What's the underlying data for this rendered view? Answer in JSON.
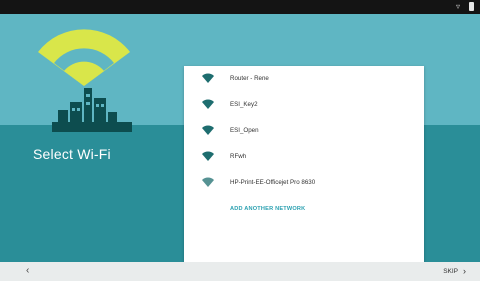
{
  "title": "Select Wi-Fi",
  "networks": [
    {
      "name": "Router - Rene",
      "icon": "wifi-secured-icon"
    },
    {
      "name": "ESI_Key2",
      "icon": "wifi-secured-icon"
    },
    {
      "name": "ESI_Open",
      "icon": "wifi-open-icon"
    },
    {
      "name": "RFwh",
      "icon": "wifi-secured-icon"
    },
    {
      "name": "HP-Print-EE-Officejet Pro 8630",
      "icon": "wifi-secured-icon"
    }
  ],
  "add_network": "ADD ANOTHER NETWORK",
  "nav": {
    "back": "‹",
    "skip": "SKIP",
    "skip_chev": "›"
  },
  "colors": {
    "accent": "#2aa0b0",
    "hero_top": "#5fb6c3",
    "hero_bottom": "#2a8e98",
    "wifi_beam": "#d9e64a"
  }
}
